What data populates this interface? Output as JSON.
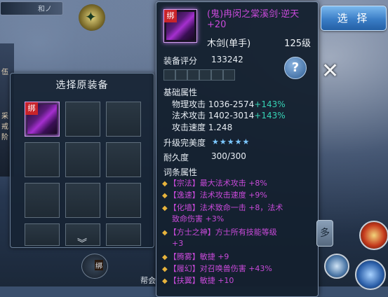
{
  "hud": {
    "player_tag": "和ノ"
  },
  "left_strip": [
    "伍",
    "采",
    "戒",
    "阶"
  ],
  "select_panel": {
    "title": "选择原装备",
    "item_bind_tag": "绑"
  },
  "tooltip": {
    "bind_tag": "绑",
    "item_name": "(鬼)冉闵之棠溪剑·逆天 +20",
    "item_type": "木剑(单手)",
    "item_level": "125级",
    "score_label": "装备评分",
    "score_value": "133242",
    "help_glyph": "?",
    "base_attr_label": "基础属性",
    "stats": [
      {
        "name": "物理攻击",
        "value": "1036-2574",
        "bonus": "+143%"
      },
      {
        "name": "法术攻击",
        "value": "1402-3014",
        "bonus": "+143%"
      },
      {
        "name": "攻击速度",
        "value": "1.248",
        "bonus": ""
      }
    ],
    "perfection_label": "升级完美度",
    "perfection_stars": "★★★★★",
    "durability_label": "耐久度",
    "durability_value": "300/300",
    "affix_label": "词条属性",
    "affixes": [
      "【宗法】最大法术攻击 +8%",
      "【逸速】法术攻击速度 +9%",
      "【化墙】法术致命一击 +8，法术",
      "致命伤害 +3%",
      "【方士之神】方士所有技能等级",
      "+3",
      "【腾雾】敏捷 +9",
      "【履幻】对召唤兽伤害 +43%",
      "【扶翼】敏捷 +10"
    ]
  },
  "select_button": "选 择",
  "close_glyph": "✕",
  "right_button": "多",
  "bottom_chip": "绑",
  "bottom_text": "帮会",
  "colors": {
    "purple": "#c84ad9",
    "bonus": "#35d2b4",
    "select_blue": "#3a7dc6"
  }
}
